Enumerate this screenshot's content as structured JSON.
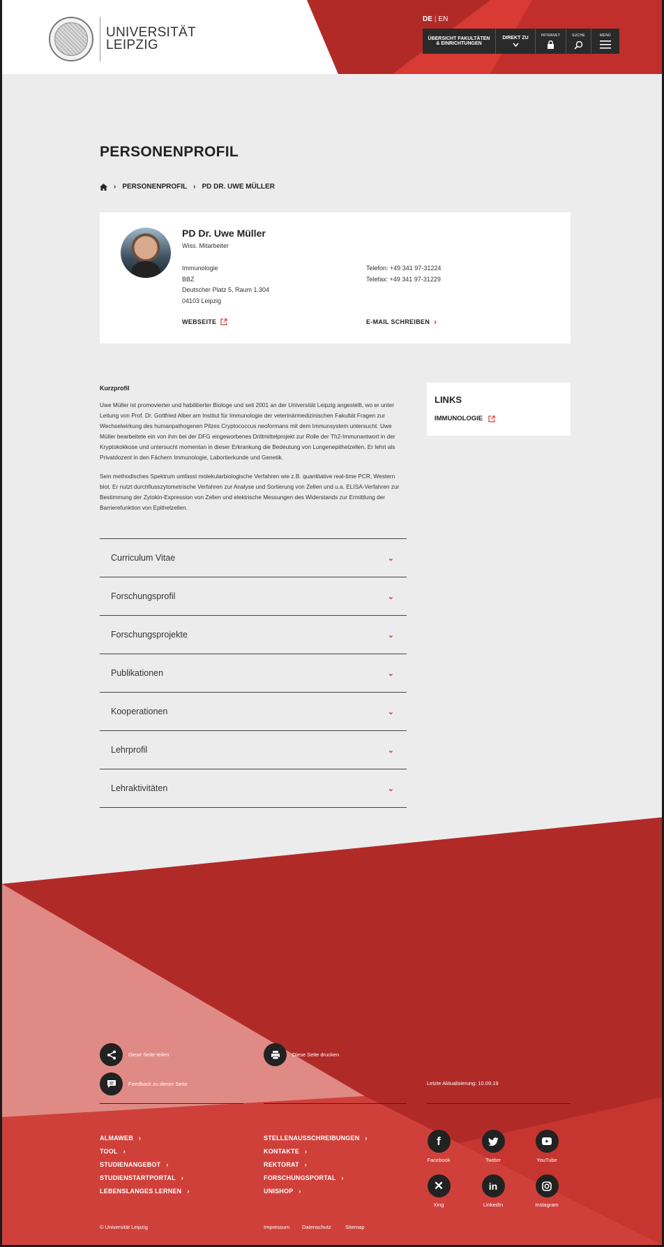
{
  "header": {
    "logo_line1": "UNIVERSITÄT",
    "logo_line2": "LEIPZIG",
    "lang_active": "DE",
    "lang_other": "EN",
    "nav": {
      "faculties_line1": "ÜBERSICHT FAKULTÄTEN",
      "faculties_line2": "& EINRICHTUNGEN",
      "direkt_zu": "DIREKT ZU",
      "intranet": "INTRANET",
      "suche": "SUCHE",
      "menu": "MENÜ"
    }
  },
  "page_title": "PERSONENPROFIL",
  "breadcrumb": [
    "PERSONENPROFIL",
    "PD DR. UWE MÜLLER"
  ],
  "person": {
    "name": "PD Dr. Uwe Müller",
    "role": "Wiss. Mitarbeiter",
    "address": [
      "Immunologie",
      "BBZ",
      "Deutscher Platz 5, Raum 1.304",
      "04103 Leipzig"
    ],
    "phone": "Telefon: +49 341 97-31224",
    "fax": "Telefax: +49 341 97-31229",
    "website_label": "WEBSEITE",
    "email_label": "E-MAIL SCHREIBEN"
  },
  "kurzprofil": {
    "heading": "Kurzprofil",
    "para1": "Uwe Müller ist promovierter und habilitierter Biologe und seit 2001 an der Universität Leipzig angestellt, wo er unter Leitung von Prof. Dr. Gottfried Alber am Institut für Immunologie der veterinärmedizinischen Fakultät Fragen zur Wechselwirkung des humanpathogenen Pilzes Cryptococcus neoformans mit dem Immunsystem untersucht. Uwe Müller bearbeitete ein von ihm bei der DFG eingeworbenes Drittmittelprojekt zur Rolle der Th2-Immunantwort in der Kryptokokkose und untersucht momentan in dieser Erkrankung die Bedeutung von Lungenepithelzellen. Er lehrt als Privatdozent in den Fächern Immunologie, Labortierkunde und Genetik.",
    "para2": "Sein methodisches Spektrum umfasst molekularbiologische Verfahren wie z.B. quantitative real-time PCR, Western blot. Er nutzt durchflusszytometrische Verfahren zur Analyse und Sortierung von Zellen und u.a. ELISA-Verfahren zur Bestimmung der Zytokin-Expression von Zellen und elektrische Messungen des Widerstands zur Ermittlung der Barrierefunktion von Epithelzellen."
  },
  "links": {
    "heading": "LINKS",
    "items": [
      "IMMUNOLOGIE"
    ]
  },
  "accordion": [
    "Curriculum Vitae",
    "Forschungsprofil",
    "Forschungsprojekte",
    "Publikationen",
    "Kooperationen",
    "Lehrprofil",
    "Lehraktivitäten"
  ],
  "footer": {
    "share": "Diese Seite teilen",
    "print": "Diese Seite drucken",
    "feedback": "Feedback zu dieser Seite",
    "updated": "Letzte Aktualisierung: 10.09.19",
    "links_col1": [
      "ALMAWEB",
      "TOOL",
      "STUDIENANGEBOT",
      "STUDIENSTARTPORTAL",
      "LEBENSLANGES LERNEN"
    ],
    "links_col2": [
      "STELLENAUSSCHREIBUNGEN",
      "KONTAKTE",
      "REKTORAT",
      "FORSCHUNGSPORTAL",
      "UNISHOP"
    ],
    "social": [
      "Facebook",
      "Twitter",
      "YouTube",
      "Xing",
      "LinkedIn",
      "Instagram"
    ],
    "copyright": "© Universität Leipzig",
    "impressum": "Impressum",
    "datenschutz": "Datenschutz",
    "sitemap": "Sitemap"
  },
  "colors": {
    "accent": "#d83a34",
    "dark": "#2a2a2a",
    "footer_red": "#c63530"
  }
}
